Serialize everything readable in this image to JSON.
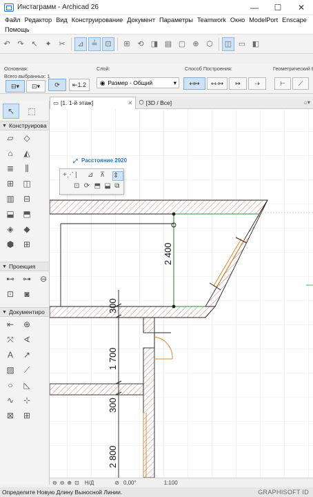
{
  "window": {
    "title": "Инстаграмм - Archicad 26",
    "minimize": "—",
    "maximize": "☐",
    "close": "✕"
  },
  "menu": {
    "row1": [
      "Файл",
      "Редактор",
      "Вид",
      "Конструирование",
      "Документ",
      "Параметры",
      "Teamwork",
      "Окно",
      "ModelPort",
      "Enscape"
    ],
    "row2": [
      "Помощь"
    ]
  },
  "infobox": {
    "main_label": "Основная:",
    "selected_label": "Всего выбранных: 1",
    "layer_label": "Слой:",
    "layer_value": "Размер - Общий",
    "construction_label": "Способ Построения:",
    "geometry_label": "Геометрический Ва"
  },
  "toolbox": {
    "sections": [
      "Конструирова",
      "Проекция",
      "Документиро"
    ]
  },
  "tabs": {
    "plan": "[1. 1-й этаж]",
    "view3d": "[3D / Все]"
  },
  "canvas": {
    "distance_label": "Расстояние",
    "distance_value": "2920",
    "dim_2400": "2 400",
    "dim_300a": "300",
    "dim_1700": "1 700",
    "dim_300b": "300",
    "dim_2800": "2 800"
  },
  "statusbar": {
    "nd": "Н/Д",
    "angle": "0,00°",
    "scale": "1:100"
  },
  "prompt": {
    "text": "Определите Новую Длину Выносной Линии.",
    "brand": "GRAPHISOFT ID"
  },
  "colors": {
    "selection_green": "#2e8b2e",
    "highlight_yellow": "#f2f21a",
    "door_orange": "#d98a2b",
    "hatch_red": "#b03030",
    "accent_blue": "#2b74c4"
  }
}
